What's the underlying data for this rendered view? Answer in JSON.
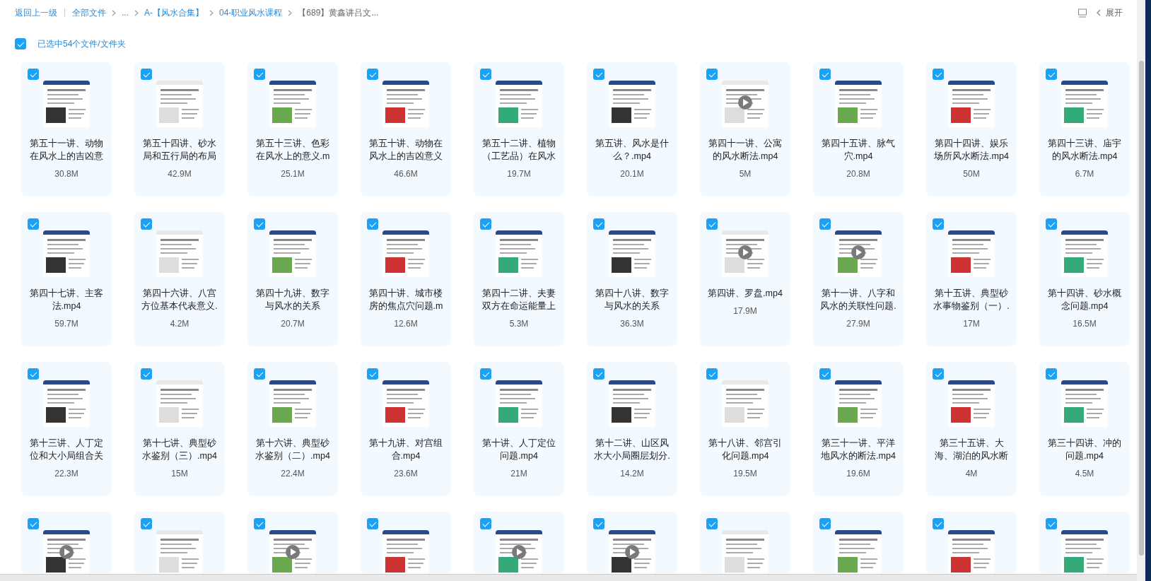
{
  "breadcrumb": {
    "back": "返回上一级",
    "items": [
      {
        "label": "全部文件"
      },
      {
        "label": "..."
      },
      {
        "label": "A-【风水合集】"
      },
      {
        "label": "04-职业风水课程"
      },
      {
        "label": "【689】黄鑫讲吕文..."
      }
    ],
    "expand": "展开"
  },
  "selection": {
    "checked": true,
    "label": "已选中54个文件/文件夹"
  },
  "files": [
    {
      "name": "第五十一讲、动物在风水上的吉凶意",
      "size": "30.8M",
      "checked": true,
      "play": false
    },
    {
      "name": "第五十四讲、砂水局和五行局的布局",
      "size": "42.9M",
      "checked": true,
      "play": false
    },
    {
      "name": "第五十三讲、色彩在风水上的意义.m",
      "size": "25.1M",
      "checked": true,
      "play": false
    },
    {
      "name": "第五十讲、动物在风水上的吉凶意义",
      "size": "46.6M",
      "checked": true,
      "play": false
    },
    {
      "name": "第五十二讲、植物（工艺品）在风水",
      "size": "19.7M",
      "checked": true,
      "play": false
    },
    {
      "name": "第五讲、风水是什么？.mp4",
      "size": "20.1M",
      "checked": true,
      "play": false
    },
    {
      "name": "第四十一讲、公寓的风水断法.mp4",
      "size": "5M",
      "checked": true,
      "play": true
    },
    {
      "name": "第四十五讲、脉气穴.mp4",
      "size": "20.8M",
      "checked": true,
      "play": false
    },
    {
      "name": "第四十四讲、娱乐场所风水断法.mp4",
      "size": "50M",
      "checked": true,
      "play": false
    },
    {
      "name": "第四十三讲、庙宇的风水断法.mp4",
      "size": "6.7M",
      "checked": true,
      "play": false
    },
    {
      "name": "第四十七讲、主客法.mp4",
      "size": "59.7M",
      "checked": true,
      "play": false
    },
    {
      "name": "第四十六讲、八宫方位基本代表意义.",
      "size": "4.2M",
      "checked": true,
      "play": false
    },
    {
      "name": "第四十九讲、数字与风水的关系",
      "size": "20.7M",
      "checked": true,
      "play": false
    },
    {
      "name": "第四十讲、城市楼房的焦点穴问题.m",
      "size": "12.6M",
      "checked": true,
      "play": false
    },
    {
      "name": "第四十二讲、夫妻双方在命运能量上",
      "size": "5.3M",
      "checked": true,
      "play": false
    },
    {
      "name": "第四十八讲、数字与风水的关系",
      "size": "36.3M",
      "checked": true,
      "play": false
    },
    {
      "name": "第四讲、罗盘.mp4",
      "size": "17.9M",
      "checked": true,
      "play": true
    },
    {
      "name": "第十一讲、八字和风水的关联性问题.",
      "size": "27.9M",
      "checked": true,
      "play": true
    },
    {
      "name": "第十五讲、典型砂水事物鉴别（一）.",
      "size": "17M",
      "checked": true,
      "play": false
    },
    {
      "name": "第十四讲、砂水概念问题.mp4",
      "size": "16.5M",
      "checked": true,
      "play": false
    },
    {
      "name": "第十三讲、人丁定位和大小局组合关",
      "size": "22.3M",
      "checked": true,
      "play": false
    },
    {
      "name": "第十七讲、典型砂水鉴别（三）.mp4",
      "size": "15M",
      "checked": true,
      "play": false
    },
    {
      "name": "第十六讲、典型砂水鉴别（二）.mp4",
      "size": "22.4M",
      "checked": true,
      "play": false
    },
    {
      "name": "第十九讲、对宫组合.mp4",
      "size": "23.6M",
      "checked": true,
      "play": false
    },
    {
      "name": "第十讲、人丁定位问题.mp4",
      "size": "21M",
      "checked": true,
      "play": false
    },
    {
      "name": "第十二讲、山区风水大小局圈层划分.",
      "size": "14.2M",
      "checked": true,
      "play": false
    },
    {
      "name": "第十八讲、邻宫引化问题.mp4",
      "size": "19.5M",
      "checked": true,
      "play": false
    },
    {
      "name": "第三十一讲、平洋地风水的断法.mp4",
      "size": "19.6M",
      "checked": true,
      "play": false
    },
    {
      "name": "第三十五讲、大海、湖泊的风水断",
      "size": "4M",
      "checked": true,
      "play": false
    },
    {
      "name": "第三十四讲、冲的问题.mp4",
      "size": "4.5M",
      "checked": true,
      "play": false
    },
    {
      "checked": true,
      "play": true
    },
    {
      "checked": true,
      "play": false
    },
    {
      "checked": true,
      "play": true
    },
    {
      "checked": true,
      "play": false
    },
    {
      "checked": true,
      "play": true
    },
    {
      "checked": true,
      "play": true
    },
    {
      "checked": true,
      "play": false
    },
    {
      "checked": true,
      "play": false
    },
    {
      "checked": true,
      "play": false
    },
    {
      "checked": true,
      "play": false
    }
  ]
}
